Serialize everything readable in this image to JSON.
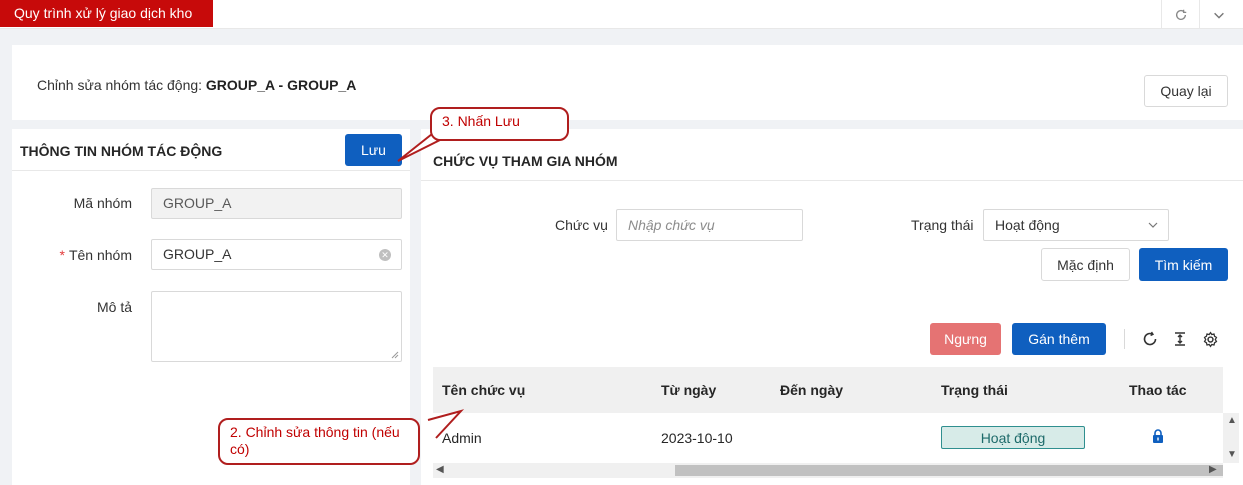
{
  "top_tab": {
    "label": "Quy trình xử lý giao dịch kho"
  },
  "top_icons": {
    "refresh": "refresh-icon",
    "collapse": "chevron-down-icon"
  },
  "header": {
    "label": "Chỉnh sửa nhóm tác động:",
    "value": "GROUP_A - GROUP_A",
    "back_button": "Quay lại"
  },
  "left": {
    "title": "THÔNG TIN NHÓM TÁC ĐỘNG",
    "save_button": "Lưu",
    "fields": {
      "code_label": "Mã nhóm",
      "code_value": "GROUP_A",
      "name_label": "Tên nhóm",
      "name_required": "*",
      "name_value": "GROUP_A",
      "desc_label": "Mô tả",
      "desc_value": ""
    }
  },
  "right": {
    "title": "CHỨC VỤ THAM GIA NHÓM",
    "filters": {
      "position_label": "Chức vụ",
      "position_placeholder": "Nhập chức vụ",
      "status_label": "Trạng thái",
      "status_value": "Hoạt động"
    },
    "buttons": {
      "reset": "Mặc định",
      "search": "Tìm kiếm",
      "stop": "Ngưng",
      "assign": "Gán thêm"
    },
    "table": {
      "columns": [
        "Tên chức vụ",
        "Từ ngày",
        "Đến ngày",
        "Trạng thái",
        "Thao tác"
      ],
      "rows": [
        {
          "name": "Admin",
          "from": "2023-10-10",
          "to": "",
          "status": "Hoạt động",
          "action_icon": "lock-icon"
        }
      ]
    }
  },
  "callouts": {
    "save": "3. Nhấn Lưu",
    "edit": "2. Chỉnh sửa thông tin (nếu có)"
  },
  "colors": {
    "brand_red": "#c70a0a",
    "primary": "#0f5fbf",
    "danger": "#e57373",
    "status_bg": "#d7ebe8",
    "callout": "#b01e1e"
  }
}
